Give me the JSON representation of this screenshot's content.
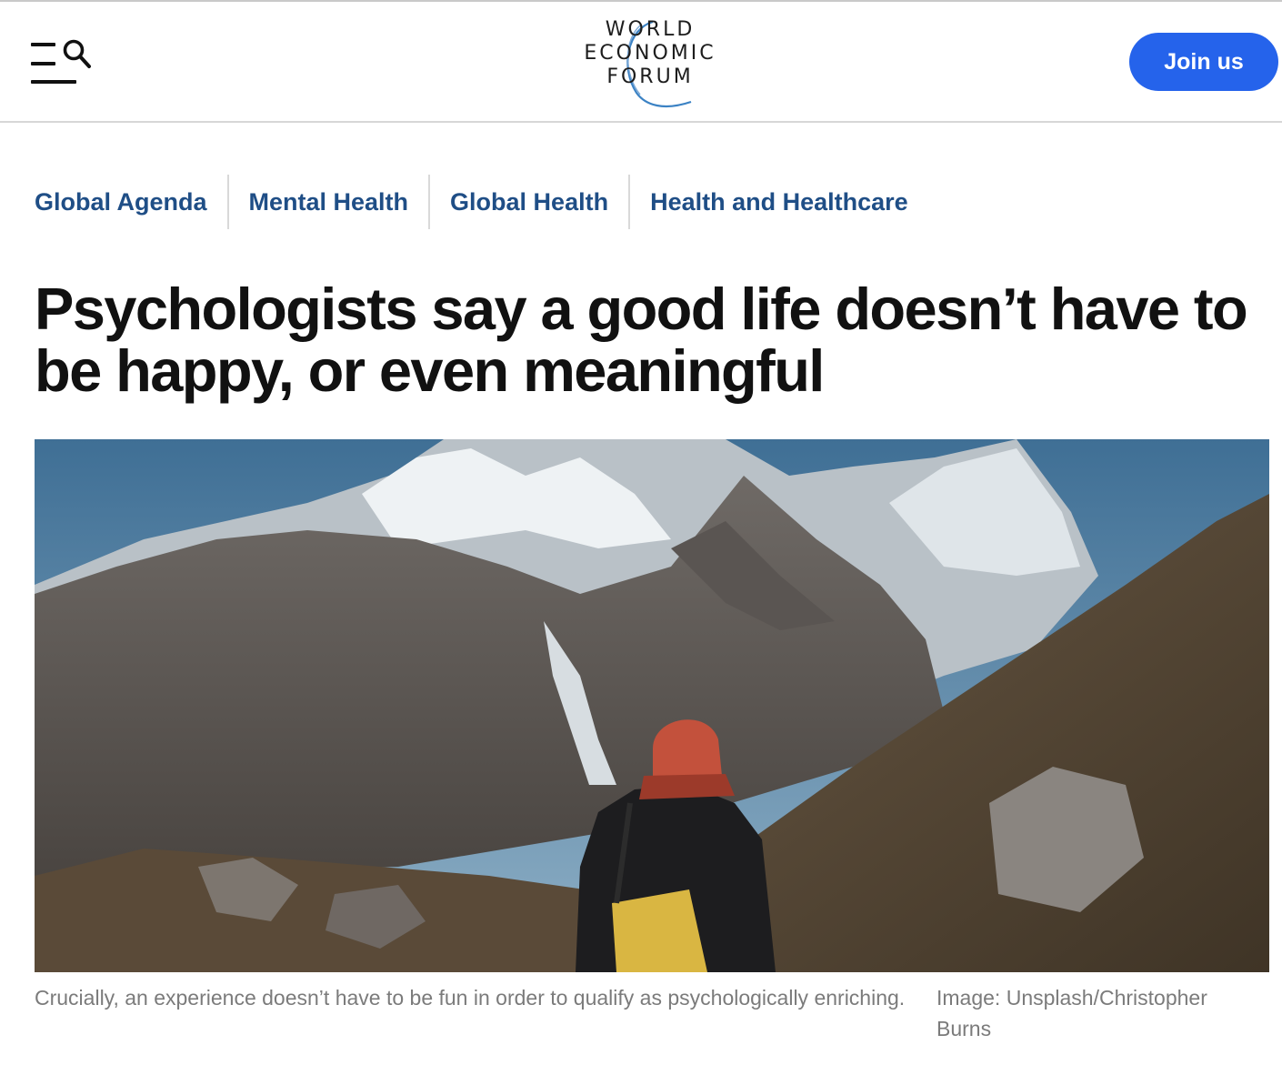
{
  "header": {
    "menu_icon": "menu-search-icon",
    "logo": {
      "line1": "WORLD",
      "line2": "ECONOMIC",
      "line3": "FORUM"
    },
    "join_label": "Join us",
    "accent_color": "#2563eb"
  },
  "tags": [
    {
      "label": "Global Agenda"
    },
    {
      "label": "Mental Health"
    },
    {
      "label": "Global Health"
    },
    {
      "label": "Health and Healthcare"
    }
  ],
  "article": {
    "title": "Psychologists say a good life doesn’t have to be happy, or even meaningful",
    "image_caption": "Crucially, an experience doesn’t have to be fun in order to qualify as psychologically enriching.",
    "image_credit": "Image: Unsplash/Christopher Burns"
  },
  "colors": {
    "tag_link": "#1f4e86",
    "caption_text": "#7b7b7b"
  }
}
